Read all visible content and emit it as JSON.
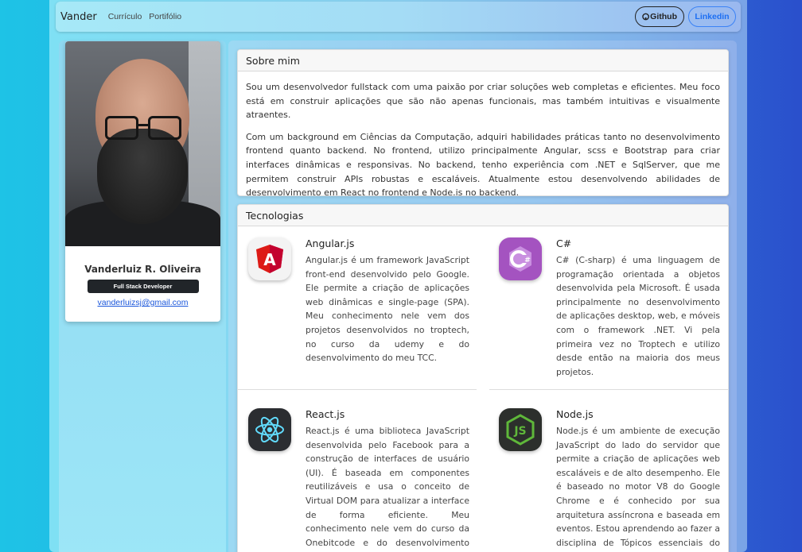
{
  "navbar": {
    "brand": "Vander",
    "links": [
      "Currículo",
      "Portifólio"
    ],
    "github_label": "Github",
    "linkedin_label": "Linkedin"
  },
  "profile": {
    "name": "Vanderluiz R. Oliveira",
    "role": "Full Stack Developer",
    "email": "vanderluizsj@gmail.com"
  },
  "about": {
    "title": "Sobre mim",
    "paragraphs": [
      "Sou um desenvolvedor fullstack com uma paixão por criar soluções web completas e eficientes. Meu foco está em construir aplicações que são não apenas funcionais, mas também intuitivas e visualmente atraentes.",
      "Com um background em Ciências da Computação, adquiri habilidades práticas tanto no desenvolvimento frontend quanto backend. No frontend, utilizo principalmente Angular, scss e Bootstrap para criar interfaces dinâmicas e responsivas. No backend, tenho experiência com .NET e SqlServer, que me permitem construir APIs robustas e escaláveis. Atualmente estou desenvolvendo abilidades de desenvolvimento em React no frontend e Node.js no backend."
    ]
  },
  "technologies": {
    "title": "Tecnologias",
    "items": [
      {
        "name": "Angular.js",
        "icon": "angular-icon",
        "color": "#dd1b16",
        "description": "Angular.js é um framework JavaScript front-end desenvolvido pelo Google. Ele permite a criação de aplicações web dinâmicas e single-page (SPA). Meu conhecimento nele vem dos projetos desenvolvidos no troptech, no curso da udemy e do desenvolvimento do meu TCC."
      },
      {
        "name": "C#",
        "icon": "csharp-icon",
        "color": "#9b4f96",
        "description": "C# (C-sharp) é uma linguagem de programação orientada a objetos desenvolvida pela Microsoft. É usada principalmente no desenvolvimento de aplicações desktop, web, e móveis com o framework .NET. Vi pela primeira vez no Troptech e utilizo desde então na maioria dos meus projetos."
      },
      {
        "name": "React.js",
        "icon": "react-icon",
        "color": "#61dafb",
        "description": "React.js é uma biblioteca JavaScript desenvolvida pelo Facebook para a construção de interfaces de usuário (UI). É baseada em componentes reutilizáveis e usa o conceito de Virtual DOM para atualizar a interface de forma eficiente. Meu conhecimento nele vem do curso da Onebitcode e do desenvolvimento desse projeto final da"
      },
      {
        "name": "Node.js",
        "icon": "nodejs-icon",
        "color": "#3c873a",
        "description": "Node.js é um ambiente de execução JavaScript do lado do servidor que permite a criação de aplicações web escaláveis e de alto desempenho. Ele é baseado no motor V8 do Google Chrome e é conhecido por sua arquitetura assíncrona e baseada em eventos. Estou aprendendo ao fazer a disciplina de Tópicos essenciais do IFSC"
      }
    ]
  }
}
